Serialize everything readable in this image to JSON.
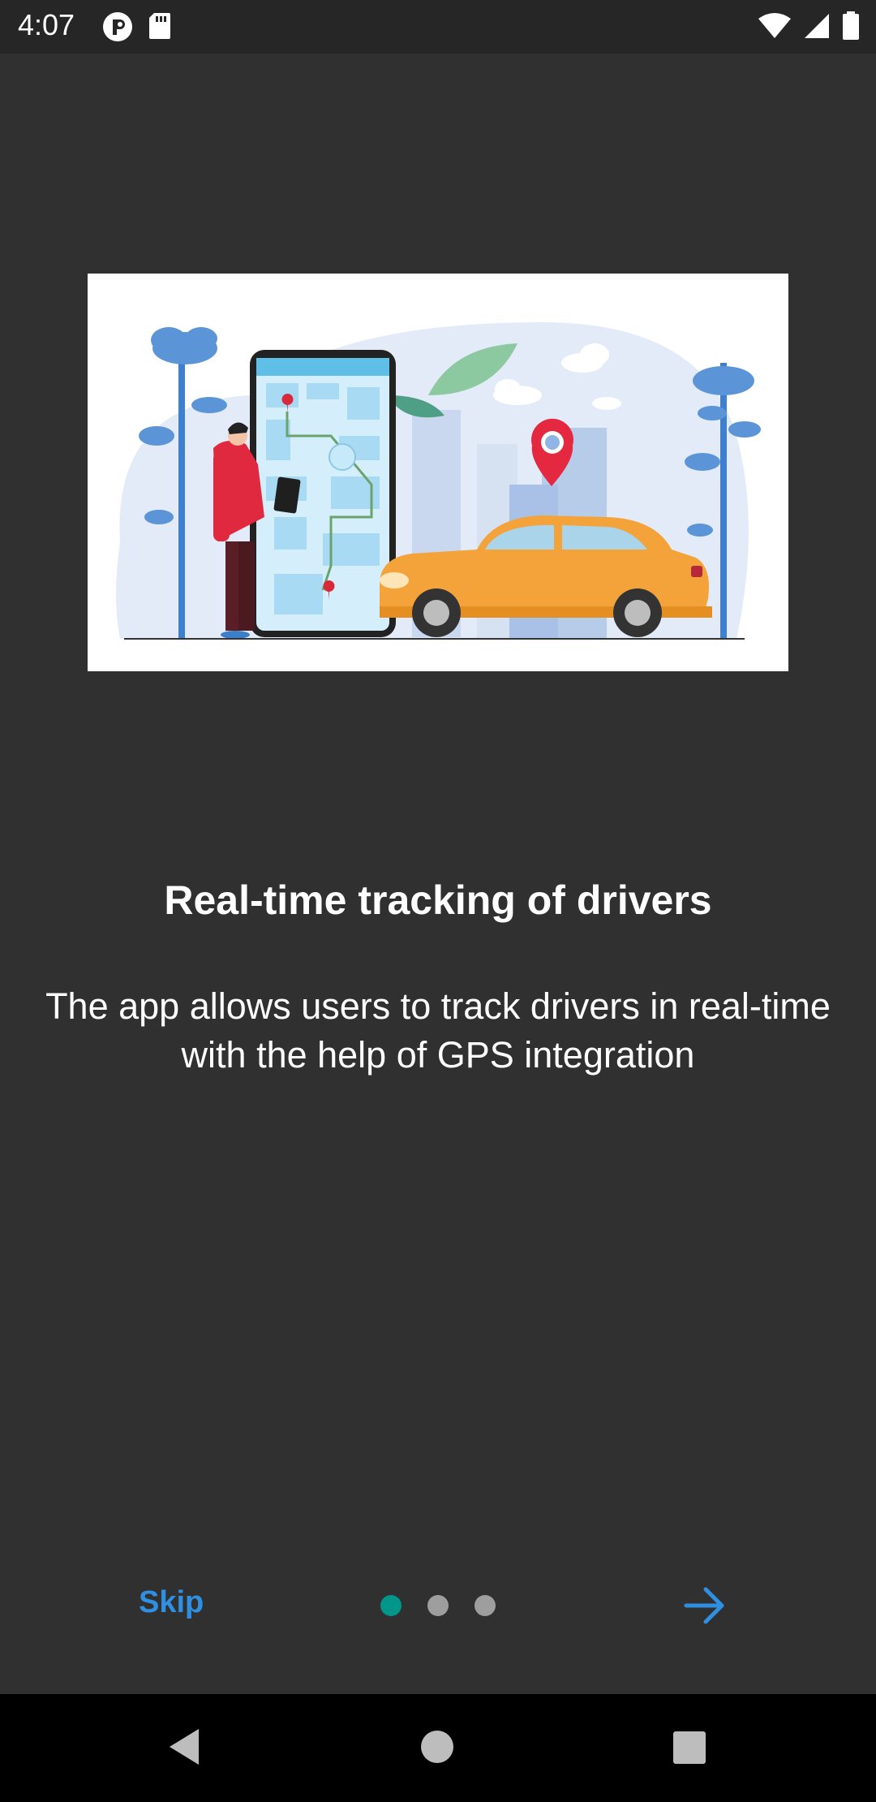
{
  "status_bar": {
    "time": "4:07",
    "icons": [
      "app-notification-icon",
      "sd-card-icon",
      "wifi-icon",
      "signal-icon",
      "battery-icon"
    ]
  },
  "onboarding": {
    "title": "Real-time tracking of drivers",
    "description": "The app allows users to track drivers in real-time with the help of GPS integration",
    "illustration": "phone-map-driver-car-illustration"
  },
  "footer": {
    "skip_label": "Skip",
    "page_count": 3,
    "current_page": 1,
    "next_icon": "arrow-right-icon"
  },
  "nav_bar": {
    "icons": [
      "back-icon",
      "home-icon",
      "recents-icon"
    ]
  },
  "colors": {
    "background": "#303030",
    "accent": "#2f8fe0",
    "active_dot": "#00968a",
    "inactive_dot": "#9e9e9e"
  }
}
